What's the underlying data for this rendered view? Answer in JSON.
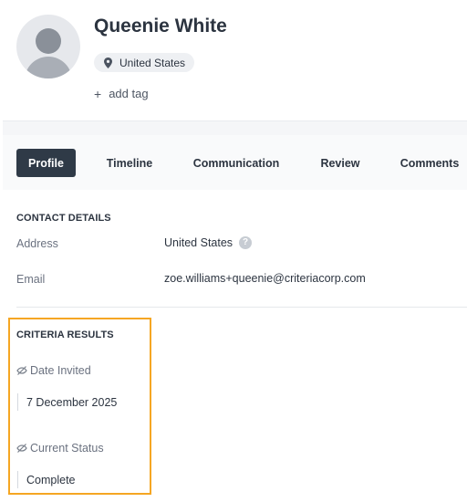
{
  "candidate": {
    "name": "Queenie White",
    "location": "United States",
    "add_tag_label": "add tag"
  },
  "tabs": [
    {
      "label": "Profile",
      "active": true
    },
    {
      "label": "Timeline",
      "active": false
    },
    {
      "label": "Communication",
      "active": false
    },
    {
      "label": "Review",
      "active": false
    },
    {
      "label": "Comments",
      "active": false
    }
  ],
  "contact_details": {
    "title": "CONTACT DETAILS",
    "address_label": "Address",
    "address_value": "United States",
    "email_label": "Email",
    "email_value": "zoe.williams+queenie@criteriacorp.com"
  },
  "criteria_results": {
    "title": "CRITERIA RESULTS",
    "date_invited_label": "Date Invited",
    "date_invited_value": "7 December 2025",
    "current_status_label": "Current Status",
    "current_status_value": "Complete"
  },
  "colors": {
    "active_tab": "#2f3a47",
    "highlight_border": "#f5a623"
  }
}
